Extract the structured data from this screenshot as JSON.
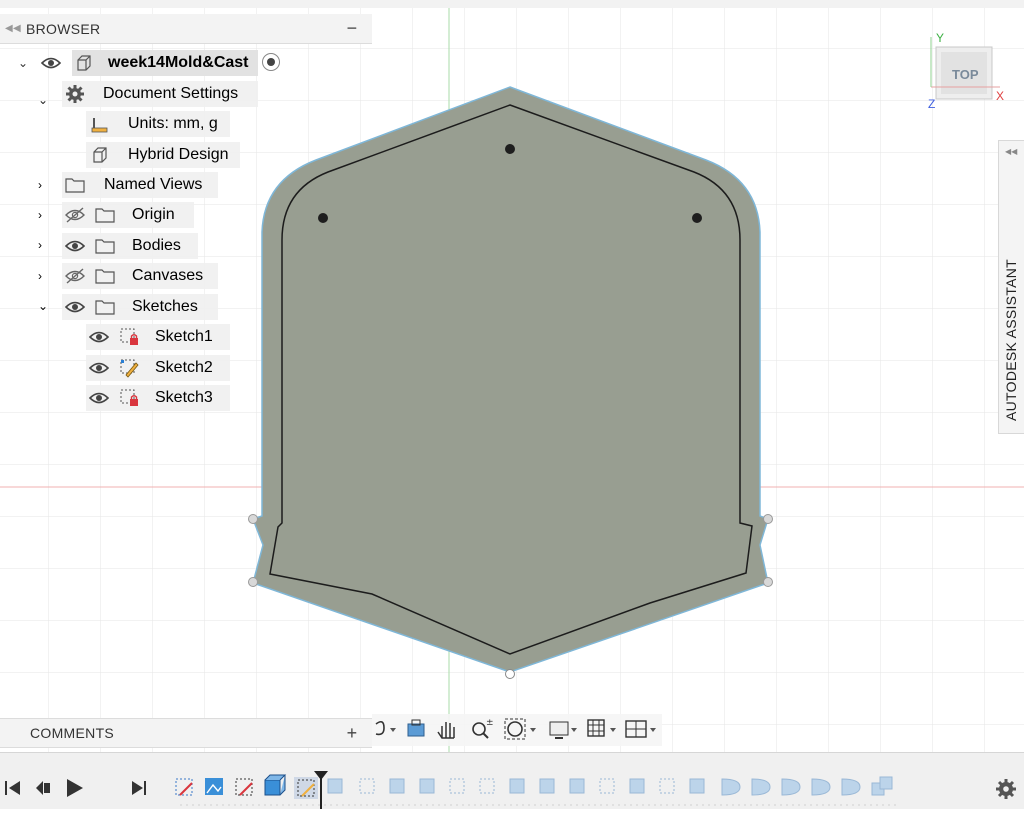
{
  "browser": {
    "title": "BROWSER",
    "collapse_icon": "double-chevron-left-icon",
    "minimize_label": "−",
    "root": {
      "label": "week14Mold&Cast"
    },
    "document_settings": {
      "label": "Document Settings"
    },
    "units": {
      "label": "Units: mm, g"
    },
    "design_type": {
      "label": "Hybrid Design"
    },
    "named_views": {
      "label": "Named Views"
    },
    "origin": {
      "label": "Origin"
    },
    "bodies": {
      "label": "Bodies"
    },
    "canvases": {
      "label": "Canvases"
    },
    "sketches": {
      "label": "Sketches"
    },
    "sketch_items": [
      {
        "label": "Sketch1",
        "icon": "sketch-locked-icon"
      },
      {
        "label": "Sketch2",
        "icon": "sketch-edit-icon"
      },
      {
        "label": "Sketch3",
        "icon": "sketch-locked-icon"
      }
    ]
  },
  "comments": {
    "title": "COMMENTS",
    "add_label": "+"
  },
  "viewcube": {
    "face": "TOP",
    "axis_x": "X",
    "axis_y": "Y",
    "axis_z": "Z"
  },
  "assistant": {
    "label": "AUTODESK ASSISTANT"
  },
  "navbar": {
    "items": [
      "orbit-icon",
      "look-at-icon",
      "pan-icon",
      "zoom-icon",
      "fit-icon",
      "display-settings-icon",
      "grid-icon",
      "viewports-icon"
    ]
  },
  "timeline": {
    "controls": [
      "skip-to-start-icon",
      "step-back-icon",
      "play-icon",
      "step-forward-icon"
    ],
    "settings_icon": "gear-icon"
  },
  "colors": {
    "part_fill": "#989e91",
    "part_outline": "#7fb7d8",
    "grid": "#e3e3e3",
    "axis_red": "#f0b0b0",
    "axis_green": "#a9dba9",
    "panel_bg": "#f3f3f3"
  }
}
